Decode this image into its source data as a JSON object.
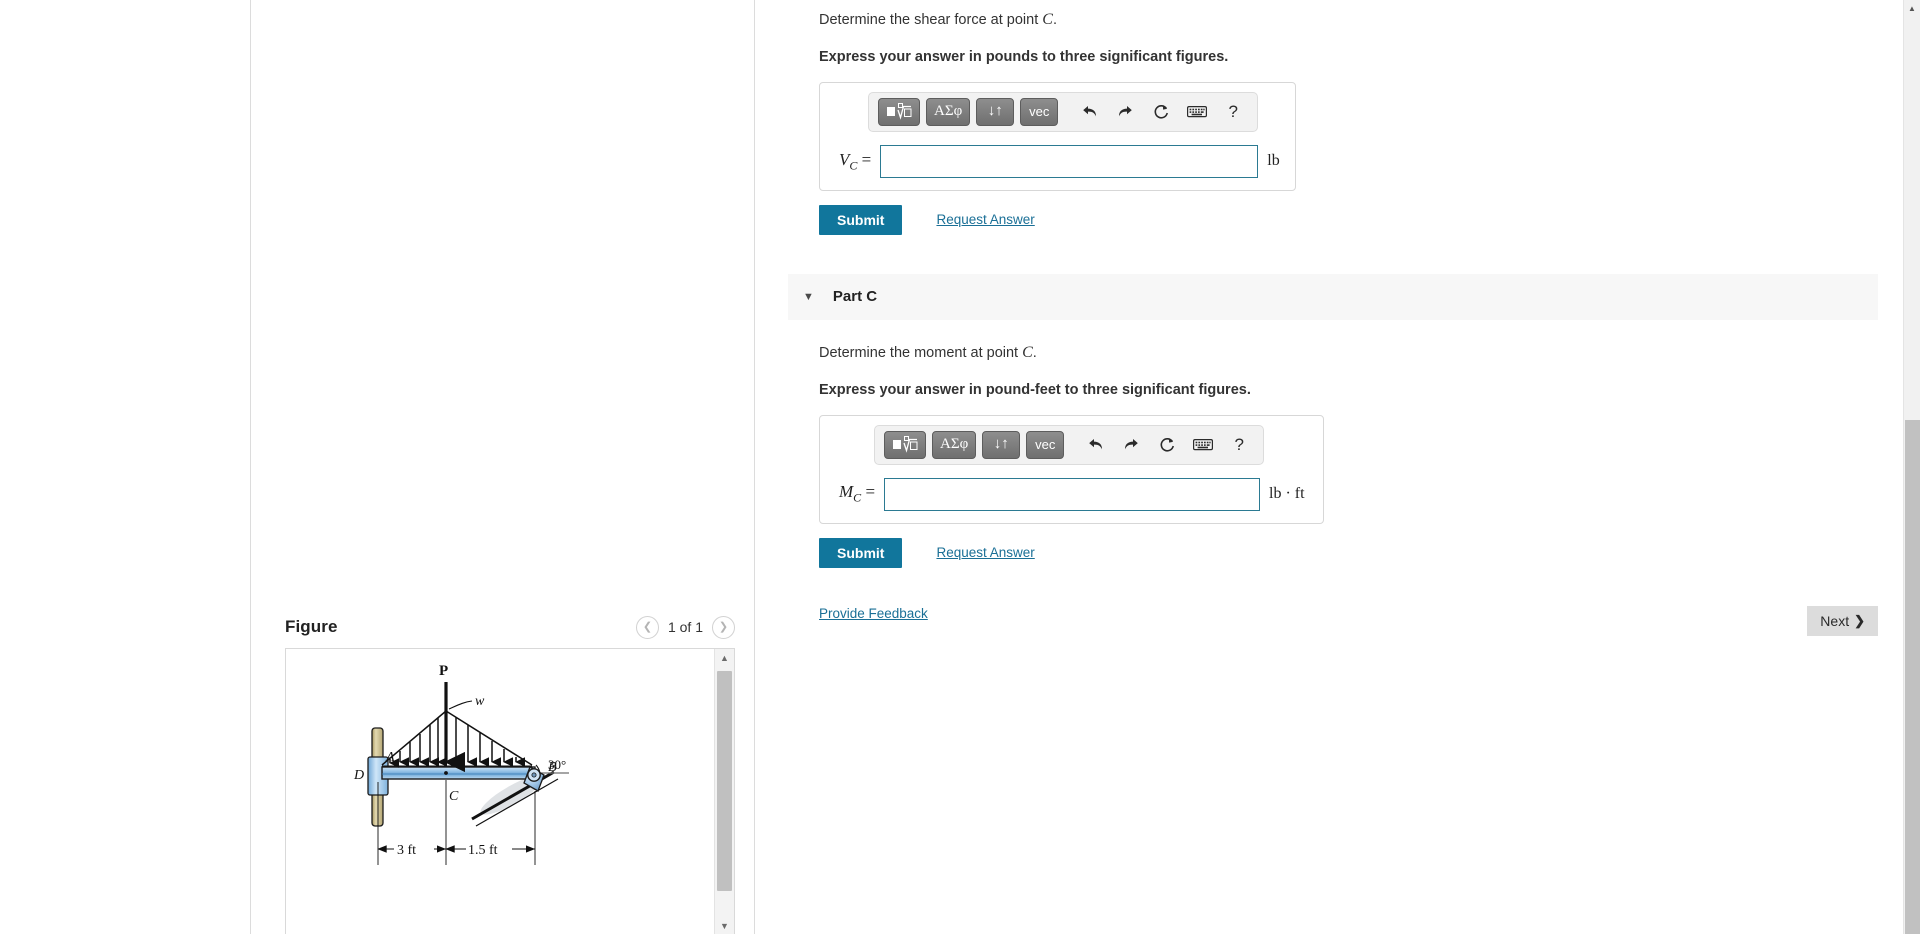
{
  "parts": [
    {
      "id": "part-b",
      "prompt_prefix": "Determine the shear force at point ",
      "prompt_var": "C",
      "prompt_suffix": ".",
      "instruction": "Express your answer in pounds to three significant figures.",
      "answer_label_main": "V",
      "answer_label_sub": "C",
      "answer_equals": "=",
      "answer_value": "",
      "unit": "lb",
      "submit_label": "Submit",
      "request_answer_label": "Request Answer"
    },
    {
      "id": "part-c",
      "header_label": "Part C",
      "prompt_prefix": "Determine the moment at point ",
      "prompt_var": "C",
      "prompt_suffix": ".",
      "instruction": "Express your answer in pound-feet to three significant figures.",
      "answer_label_main": "M",
      "answer_label_sub": "C",
      "answer_equals": "=",
      "answer_value": "",
      "unit": "lb · ft",
      "submit_label": "Submit",
      "request_answer_label": "Request Answer"
    }
  ],
  "toolbar": {
    "template_label": "▪√▫",
    "greek_label": "ΑΣφ",
    "arrows_label": "↓↑",
    "vec_label": "vec",
    "undo_icon": "↰",
    "redo_icon": "↱",
    "reset_icon": "↻",
    "keyboard_icon": "⌨",
    "help_icon": "?"
  },
  "footer": {
    "feedback_label": "Provide Feedback",
    "next_label": "Next",
    "next_chevron": "❯"
  },
  "figure": {
    "title": "Figure",
    "pager_label": "1 of 1",
    "prev_icon": "❮",
    "next_icon": "❯",
    "scroll_up_icon": "▲",
    "scroll_down_icon": "▼",
    "diagram": {
      "labels": {
        "point_load": "P",
        "distributed_load": "w",
        "point_a": "A",
        "point_b": "B",
        "point_c": "C",
        "point_d": "D",
        "angle": "30°",
        "dim_left": "3 ft",
        "dim_right": "1.5 ft"
      },
      "colors": {
        "beam_fill": "#9cc6e8",
        "beam_edge": "#1b1b1b",
        "collar_rod": "#cbbd8e",
        "collar_sleeve": "#8fc0e6",
        "support_fill": "#a9c8e4"
      }
    }
  },
  "scrollbars": {
    "page_up_icon": "▲"
  }
}
